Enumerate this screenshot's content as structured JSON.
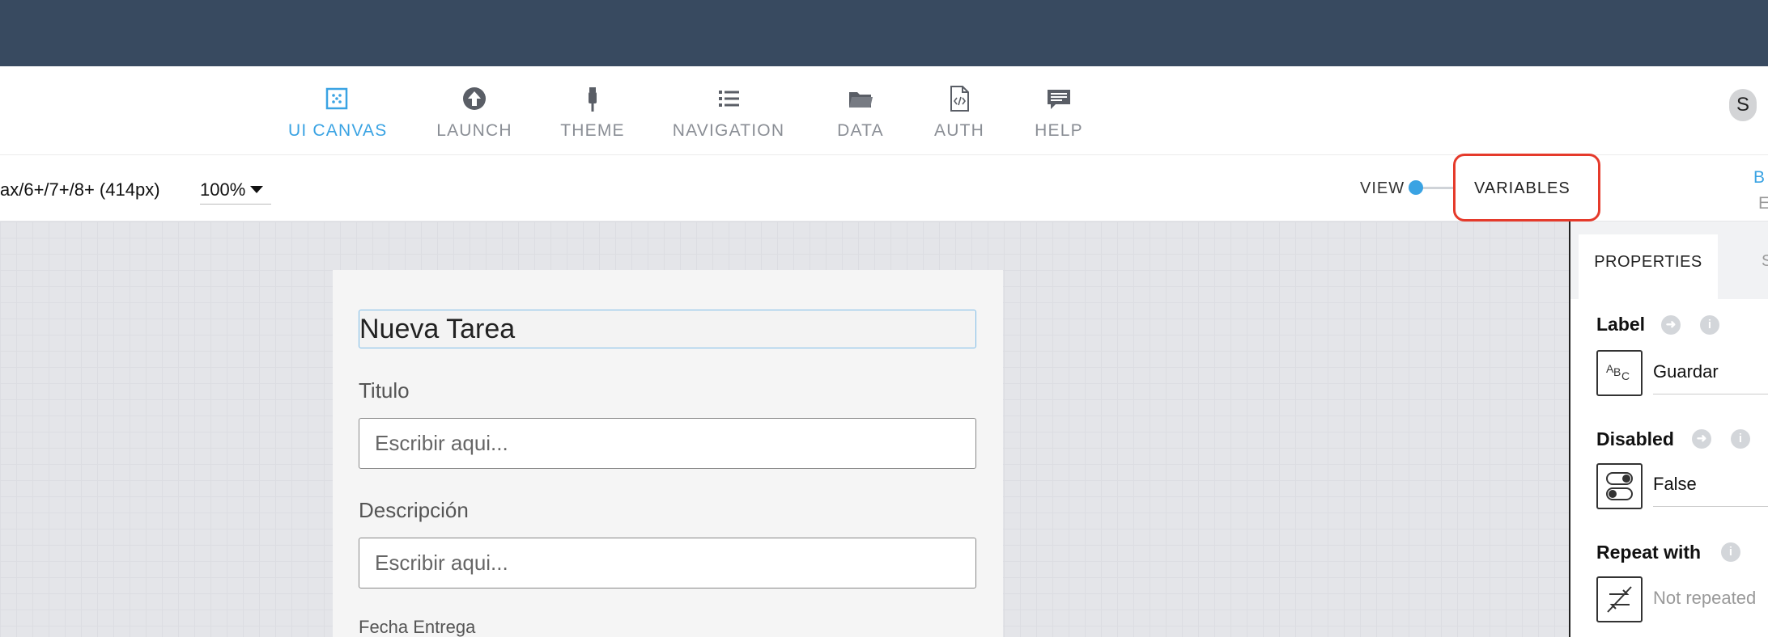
{
  "nav": {
    "items": [
      {
        "label": "UI CANVAS",
        "icon": "ui-canvas-icon"
      },
      {
        "label": "LAUNCH",
        "icon": "launch-icon"
      },
      {
        "label": "THEME",
        "icon": "theme-icon"
      },
      {
        "label": "NAVIGATION",
        "icon": "navigation-icon"
      },
      {
        "label": "DATA",
        "icon": "data-icon"
      },
      {
        "label": "AUTH",
        "icon": "auth-icon"
      },
      {
        "label": "HELP",
        "icon": "help-icon"
      }
    ],
    "active": "UI CANVAS",
    "avatar_initial": "S"
  },
  "toolbar": {
    "device": "ax/6+/7+/8+ (414px)",
    "zoom": "100%",
    "view_label": "VIEW",
    "variables_label": "VARIABLES",
    "edge_top": "B",
    "edge_bottom": "E"
  },
  "screen": {
    "title": "Nueva Tarea",
    "fields": [
      {
        "label": "Titulo",
        "placeholder": "Escribir aqui..."
      },
      {
        "label": "Descripción",
        "placeholder": "Escribir aqui..."
      }
    ],
    "date_label": "Fecha Entrega"
  },
  "panel": {
    "tab_properties": "PROPERTIES",
    "tab_second": "S",
    "label_title": "Label",
    "label_icon_text": "ABC",
    "label_value": "Guardar",
    "disabled_title": "Disabled",
    "disabled_value": "False",
    "repeat_title": "Repeat with",
    "repeat_value": "Not repeated"
  },
  "colors": {
    "topbar": "#384a60",
    "accent": "#3aa3e3",
    "highlight": "#e53a2b"
  }
}
